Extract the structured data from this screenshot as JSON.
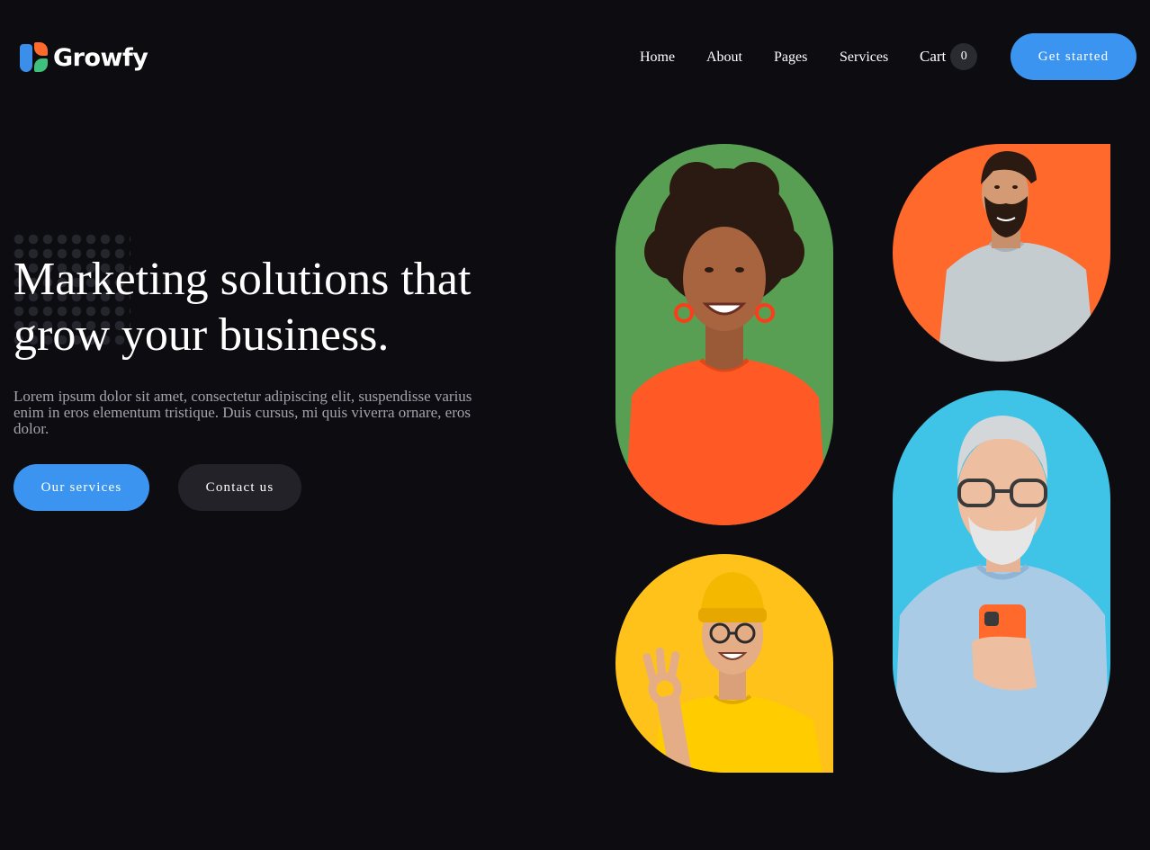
{
  "brand": {
    "name": "Growfy",
    "logo_colors": [
      "#3b8eea",
      "#ff6a2c",
      "#3fc07c"
    ]
  },
  "nav": {
    "items": [
      {
        "label": "Home"
      },
      {
        "label": "About"
      },
      {
        "label": "Pages"
      },
      {
        "label": "Services"
      }
    ],
    "cart_label": "Cart",
    "cart_count": "0",
    "cta_label": "Get started"
  },
  "hero": {
    "title_line1": "Marketing solutions that",
    "title_line2": "grow your business.",
    "description": "Lorem ipsum dolor sit amet, consectetur adipiscing elit, suspendisse varius enim in eros elementum tristique. Duis cursus, mi quis viverra ornare, eros dolor.",
    "primary_button": "Our services",
    "secondary_button": "Contact us"
  },
  "photos": [
    {
      "name": "smiling-woman-photo",
      "background": "#5fa85a"
    },
    {
      "name": "bearded-man-photo",
      "background": "#ff6a2c"
    },
    {
      "name": "man-yellow-beanie-photo",
      "background": "#ffc21a"
    },
    {
      "name": "older-man-phone-photo",
      "background": "#3fc3e6"
    }
  ],
  "colors": {
    "background": "#0c0c11",
    "accent": "#3b95f0",
    "secondary_button": "#222228",
    "muted_text": "#a3a3ab"
  }
}
